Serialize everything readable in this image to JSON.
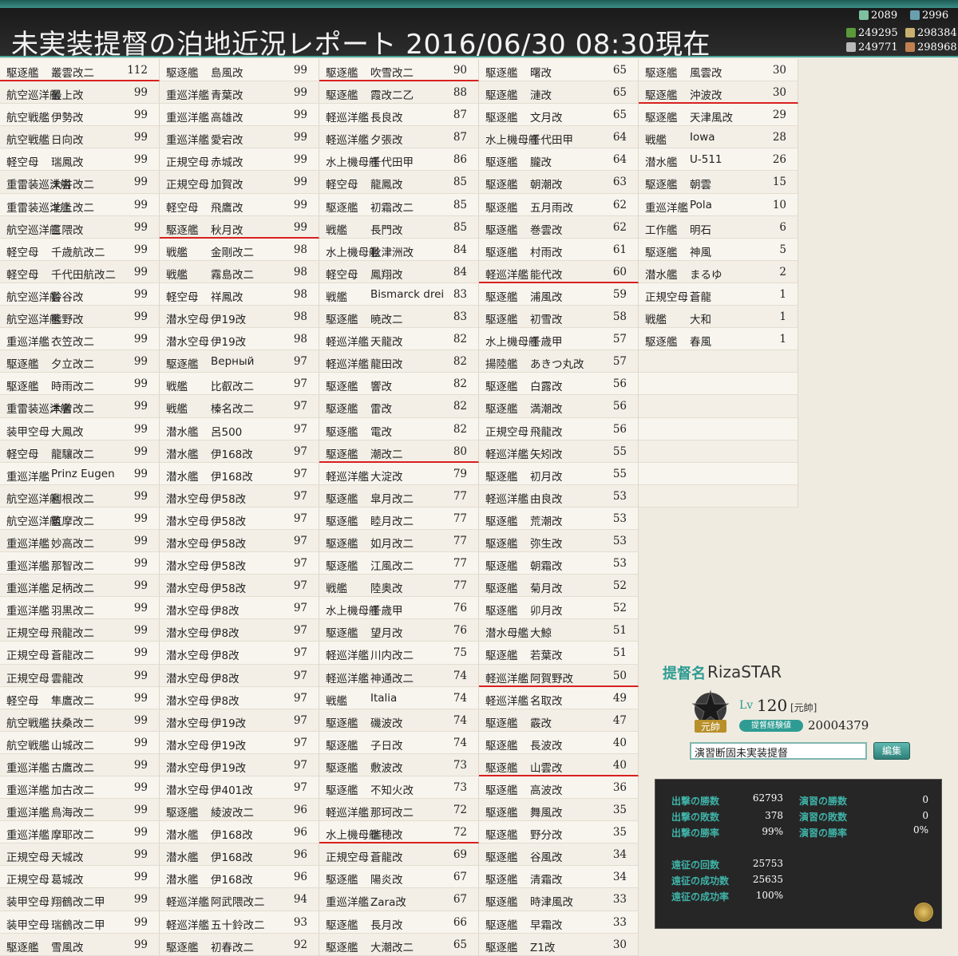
{
  "title": "未実装提督の泊地近況レポート 2016/06/30 08:30現在",
  "resources": {
    "bucket": "2089",
    "dev_material": "2996",
    "fuel": "249295",
    "ammo": "298384",
    "steel": "249771",
    "bauxite": "298968"
  },
  "columns": [
    [
      {
        "t": "駆逐艦",
        "n": "叢雲改二",
        "lv": "112",
        "m": true
      },
      {
        "t": "航空巡洋艦",
        "n": "最上改",
        "lv": "99"
      },
      {
        "t": "航空戦艦",
        "n": "伊勢改",
        "lv": "99"
      },
      {
        "t": "航空戦艦",
        "n": "日向改",
        "lv": "99"
      },
      {
        "t": "軽空母",
        "n": "瑞鳳改",
        "lv": "99"
      },
      {
        "t": "重雷装巡洋艦",
        "n": "大井改二",
        "lv": "99"
      },
      {
        "t": "重雷装巡洋艦",
        "n": "北上改二",
        "lv": "99"
      },
      {
        "t": "航空巡洋艦",
        "n": "三隈改",
        "lv": "99"
      },
      {
        "t": "軽空母",
        "n": "千歳航改二",
        "lv": "99"
      },
      {
        "t": "軽空母",
        "n": "千代田航改二",
        "lv": "99"
      },
      {
        "t": "航空巡洋艦",
        "n": "鈴谷改",
        "lv": "99"
      },
      {
        "t": "航空巡洋艦",
        "n": "熊野改",
        "lv": "99"
      },
      {
        "t": "重巡洋艦",
        "n": "衣笠改二",
        "lv": "99"
      },
      {
        "t": "駆逐艦",
        "n": "夕立改二",
        "lv": "99"
      },
      {
        "t": "駆逐艦",
        "n": "時雨改二",
        "lv": "99"
      },
      {
        "t": "重雷装巡洋艦",
        "n": "木曾改二",
        "lv": "99"
      },
      {
        "t": "装甲空母",
        "n": "大鳳改",
        "lv": "99"
      },
      {
        "t": "軽空母",
        "n": "龍驤改二",
        "lv": "99"
      },
      {
        "t": "重巡洋艦",
        "n": "Prinz Eugen",
        "lv": "99"
      },
      {
        "t": "航空巡洋艦",
        "n": "利根改二",
        "lv": "99"
      },
      {
        "t": "航空巡洋艦",
        "n": "筑摩改二",
        "lv": "99"
      },
      {
        "t": "重巡洋艦",
        "n": "妙高改二",
        "lv": "99"
      },
      {
        "t": "重巡洋艦",
        "n": "那智改二",
        "lv": "99"
      },
      {
        "t": "重巡洋艦",
        "n": "足柄改二",
        "lv": "99"
      },
      {
        "t": "重巡洋艦",
        "n": "羽黒改二",
        "lv": "99"
      },
      {
        "t": "正規空母",
        "n": "飛龍改二",
        "lv": "99"
      },
      {
        "t": "正規空母",
        "n": "蒼龍改二",
        "lv": "99"
      },
      {
        "t": "正規空母",
        "n": "雲龍改",
        "lv": "99"
      },
      {
        "t": "軽空母",
        "n": "隼鷹改二",
        "lv": "99"
      },
      {
        "t": "航空戦艦",
        "n": "扶桑改二",
        "lv": "99"
      },
      {
        "t": "航空戦艦",
        "n": "山城改二",
        "lv": "99"
      },
      {
        "t": "重巡洋艦",
        "n": "古鷹改二",
        "lv": "99"
      },
      {
        "t": "重巡洋艦",
        "n": "加古改二",
        "lv": "99"
      },
      {
        "t": "重巡洋艦",
        "n": "鳥海改二",
        "lv": "99"
      },
      {
        "t": "重巡洋艦",
        "n": "摩耶改二",
        "lv": "99"
      },
      {
        "t": "正規空母",
        "n": "天城改",
        "lv": "99"
      },
      {
        "t": "正規空母",
        "n": "葛城改",
        "lv": "99"
      },
      {
        "t": "装甲空母",
        "n": "翔鶴改二甲",
        "lv": "99"
      },
      {
        "t": "装甲空母",
        "n": "瑞鶴改二甲",
        "lv": "99"
      },
      {
        "t": "駆逐艦",
        "n": "雪風改",
        "lv": "99"
      }
    ],
    [
      {
        "t": "駆逐艦",
        "n": "島風改",
        "lv": "99"
      },
      {
        "t": "重巡洋艦",
        "n": "青葉改",
        "lv": "99"
      },
      {
        "t": "重巡洋艦",
        "n": "高雄改",
        "lv": "99"
      },
      {
        "t": "重巡洋艦",
        "n": "愛宕改",
        "lv": "99"
      },
      {
        "t": "正規空母",
        "n": "赤城改",
        "lv": "99"
      },
      {
        "t": "正規空母",
        "n": "加賀改",
        "lv": "99"
      },
      {
        "t": "軽空母",
        "n": "飛鷹改",
        "lv": "99"
      },
      {
        "t": "駆逐艦",
        "n": "秋月改",
        "lv": "99",
        "m": true
      },
      {
        "t": "戦艦",
        "n": "金剛改二",
        "lv": "98"
      },
      {
        "t": "戦艦",
        "n": "霧島改二",
        "lv": "98"
      },
      {
        "t": "軽空母",
        "n": "祥鳳改",
        "lv": "98"
      },
      {
        "t": "潜水空母",
        "n": "伊19改",
        "lv": "98"
      },
      {
        "t": "潜水空母",
        "n": "伊19改",
        "lv": "98"
      },
      {
        "t": "駆逐艦",
        "n": "Верный",
        "lv": "97"
      },
      {
        "t": "戦艦",
        "n": "比叡改二",
        "lv": "97"
      },
      {
        "t": "戦艦",
        "n": "榛名改二",
        "lv": "97"
      },
      {
        "t": "潜水艦",
        "n": "呂500",
        "lv": "97"
      },
      {
        "t": "潜水艦",
        "n": "伊168改",
        "lv": "97"
      },
      {
        "t": "潜水艦",
        "n": "伊168改",
        "lv": "97"
      },
      {
        "t": "潜水空母",
        "n": "伊58改",
        "lv": "97"
      },
      {
        "t": "潜水空母",
        "n": "伊58改",
        "lv": "97"
      },
      {
        "t": "潜水空母",
        "n": "伊58改",
        "lv": "97"
      },
      {
        "t": "潜水空母",
        "n": "伊58改",
        "lv": "97"
      },
      {
        "t": "潜水空母",
        "n": "伊58改",
        "lv": "97"
      },
      {
        "t": "潜水空母",
        "n": "伊8改",
        "lv": "97"
      },
      {
        "t": "潜水空母",
        "n": "伊8改",
        "lv": "97"
      },
      {
        "t": "潜水空母",
        "n": "伊8改",
        "lv": "97"
      },
      {
        "t": "潜水空母",
        "n": "伊8改",
        "lv": "97"
      },
      {
        "t": "潜水空母",
        "n": "伊8改",
        "lv": "97"
      },
      {
        "t": "潜水空母",
        "n": "伊19改",
        "lv": "97"
      },
      {
        "t": "潜水空母",
        "n": "伊19改",
        "lv": "97"
      },
      {
        "t": "潜水空母",
        "n": "伊19改",
        "lv": "97"
      },
      {
        "t": "潜水空母",
        "n": "伊401改",
        "lv": "97"
      },
      {
        "t": "駆逐艦",
        "n": "綾波改二",
        "lv": "96"
      },
      {
        "t": "潜水艦",
        "n": "伊168改",
        "lv": "96"
      },
      {
        "t": "潜水艦",
        "n": "伊168改",
        "lv": "96"
      },
      {
        "t": "潜水艦",
        "n": "伊168改",
        "lv": "96"
      },
      {
        "t": "軽巡洋艦",
        "n": "阿武隈改二",
        "lv": "94"
      },
      {
        "t": "軽巡洋艦",
        "n": "五十鈴改二",
        "lv": "93"
      },
      {
        "t": "駆逐艦",
        "n": "初春改二",
        "lv": "92"
      }
    ],
    [
      {
        "t": "駆逐艦",
        "n": "吹雪改二",
        "lv": "90",
        "m": true
      },
      {
        "t": "駆逐艦",
        "n": "霞改二乙",
        "lv": "88"
      },
      {
        "t": "軽巡洋艦",
        "n": "長良改",
        "lv": "87"
      },
      {
        "t": "軽巡洋艦",
        "n": "夕張改",
        "lv": "87"
      },
      {
        "t": "水上機母艦",
        "n": "千代田甲",
        "lv": "86"
      },
      {
        "t": "軽空母",
        "n": "龍鳳改",
        "lv": "85"
      },
      {
        "t": "駆逐艦",
        "n": "初霜改二",
        "lv": "85"
      },
      {
        "t": "戦艦",
        "n": "長門改",
        "lv": "85"
      },
      {
        "t": "水上機母艦",
        "n": "秋津洲改",
        "lv": "84"
      },
      {
        "t": "軽空母",
        "n": "鳳翔改",
        "lv": "84"
      },
      {
        "t": "戦艦",
        "n": "Bismarck drei",
        "lv": "83"
      },
      {
        "t": "駆逐艦",
        "n": "暁改二",
        "lv": "83"
      },
      {
        "t": "軽巡洋艦",
        "n": "天龍改",
        "lv": "82"
      },
      {
        "t": "軽巡洋艦",
        "n": "龍田改",
        "lv": "82"
      },
      {
        "t": "駆逐艦",
        "n": "響改",
        "lv": "82"
      },
      {
        "t": "駆逐艦",
        "n": "雷改",
        "lv": "82"
      },
      {
        "t": "駆逐艦",
        "n": "電改",
        "lv": "82"
      },
      {
        "t": "駆逐艦",
        "n": "潮改二",
        "lv": "80",
        "m": true
      },
      {
        "t": "軽巡洋艦",
        "n": "大淀改",
        "lv": "79"
      },
      {
        "t": "駆逐艦",
        "n": "皐月改二",
        "lv": "77"
      },
      {
        "t": "駆逐艦",
        "n": "睦月改二",
        "lv": "77"
      },
      {
        "t": "駆逐艦",
        "n": "如月改二",
        "lv": "77"
      },
      {
        "t": "駆逐艦",
        "n": "江風改二",
        "lv": "77"
      },
      {
        "t": "戦艦",
        "n": "陸奥改",
        "lv": "77"
      },
      {
        "t": "水上機母艦",
        "n": "千歳甲",
        "lv": "76"
      },
      {
        "t": "駆逐艦",
        "n": "望月改",
        "lv": "76"
      },
      {
        "t": "軽巡洋艦",
        "n": "川内改二",
        "lv": "75"
      },
      {
        "t": "軽巡洋艦",
        "n": "神通改二",
        "lv": "74"
      },
      {
        "t": "戦艦",
        "n": "Italia",
        "lv": "74"
      },
      {
        "t": "駆逐艦",
        "n": "磯波改",
        "lv": "74"
      },
      {
        "t": "駆逐艦",
        "n": "子日改",
        "lv": "74"
      },
      {
        "t": "駆逐艦",
        "n": "敷波改",
        "lv": "73"
      },
      {
        "t": "駆逐艦",
        "n": "不知火改",
        "lv": "73"
      },
      {
        "t": "軽巡洋艦",
        "n": "那珂改二",
        "lv": "72"
      },
      {
        "t": "水上機母艦",
        "n": "瑞穂改",
        "lv": "72",
        "m": true
      },
      {
        "t": "正規空母",
        "n": "蒼龍改",
        "lv": "69"
      },
      {
        "t": "駆逐艦",
        "n": "陽炎改",
        "lv": "67"
      },
      {
        "t": "重巡洋艦",
        "n": "Zara改",
        "lv": "67"
      },
      {
        "t": "駆逐艦",
        "n": "長月改",
        "lv": "66"
      },
      {
        "t": "駆逐艦",
        "n": "大潮改二",
        "lv": "65"
      }
    ],
    [
      {
        "t": "駆逐艦",
        "n": "曙改",
        "lv": "65"
      },
      {
        "t": "駆逐艦",
        "n": "漣改",
        "lv": "65"
      },
      {
        "t": "駆逐艦",
        "n": "文月改",
        "lv": "65"
      },
      {
        "t": "水上機母艦",
        "n": "千代田甲",
        "lv": "64"
      },
      {
        "t": "駆逐艦",
        "n": "朧改",
        "lv": "64"
      },
      {
        "t": "駆逐艦",
        "n": "朝潮改",
        "lv": "63"
      },
      {
        "t": "駆逐艦",
        "n": "五月雨改",
        "lv": "62"
      },
      {
        "t": "駆逐艦",
        "n": "巻雲改",
        "lv": "62"
      },
      {
        "t": "駆逐艦",
        "n": "村雨改",
        "lv": "61"
      },
      {
        "t": "軽巡洋艦",
        "n": "能代改",
        "lv": "60",
        "m": true
      },
      {
        "t": "駆逐艦",
        "n": "浦風改",
        "lv": "59"
      },
      {
        "t": "駆逐艦",
        "n": "初雪改",
        "lv": "58"
      },
      {
        "t": "水上機母艦",
        "n": "千歳甲",
        "lv": "57"
      },
      {
        "t": "揚陸艦",
        "n": "あきつ丸改",
        "lv": "57"
      },
      {
        "t": "駆逐艦",
        "n": "白露改",
        "lv": "56"
      },
      {
        "t": "駆逐艦",
        "n": "満潮改",
        "lv": "56"
      },
      {
        "t": "正規空母",
        "n": "飛龍改",
        "lv": "56"
      },
      {
        "t": "軽巡洋艦",
        "n": "矢矧改",
        "lv": "55"
      },
      {
        "t": "駆逐艦",
        "n": "初月改",
        "lv": "55"
      },
      {
        "t": "軽巡洋艦",
        "n": "由良改",
        "lv": "53"
      },
      {
        "t": "駆逐艦",
        "n": "荒潮改",
        "lv": "53"
      },
      {
        "t": "駆逐艦",
        "n": "弥生改",
        "lv": "53"
      },
      {
        "t": "駆逐艦",
        "n": "朝霜改",
        "lv": "53"
      },
      {
        "t": "駆逐艦",
        "n": "菊月改",
        "lv": "52"
      },
      {
        "t": "駆逐艦",
        "n": "卯月改",
        "lv": "52"
      },
      {
        "t": "潜水母艦",
        "n": "大鯨",
        "lv": "51"
      },
      {
        "t": "駆逐艦",
        "n": "若葉改",
        "lv": "51"
      },
      {
        "t": "軽巡洋艦",
        "n": "阿賀野改",
        "lv": "50",
        "m": true
      },
      {
        "t": "軽巡洋艦",
        "n": "名取改",
        "lv": "49"
      },
      {
        "t": "駆逐艦",
        "n": "霰改",
        "lv": "47"
      },
      {
        "t": "駆逐艦",
        "n": "長波改",
        "lv": "40"
      },
      {
        "t": "駆逐艦",
        "n": "山雲改",
        "lv": "40",
        "m": true
      },
      {
        "t": "駆逐艦",
        "n": "高波改",
        "lv": "36"
      },
      {
        "t": "駆逐艦",
        "n": "舞風改",
        "lv": "35"
      },
      {
        "t": "駆逐艦",
        "n": "野分改",
        "lv": "35"
      },
      {
        "t": "駆逐艦",
        "n": "谷風改",
        "lv": "34"
      },
      {
        "t": "駆逐艦",
        "n": "清霜改",
        "lv": "34"
      },
      {
        "t": "駆逐艦",
        "n": "時津風改",
        "lv": "33"
      },
      {
        "t": "駆逐艦",
        "n": "早霜改",
        "lv": "33"
      },
      {
        "t": "駆逐艦",
        "n": "Z1改",
        "lv": "30"
      }
    ],
    [
      {
        "t": "駆逐艦",
        "n": "風雲改",
        "lv": "30"
      },
      {
        "t": "駆逐艦",
        "n": "沖波改",
        "lv": "30",
        "m": true
      },
      {
        "t": "駆逐艦",
        "n": "天津風改",
        "lv": "29"
      },
      {
        "t": "戦艦",
        "n": "Iowa",
        "lv": "28"
      },
      {
        "t": "潜水艦",
        "n": "U-511",
        "lv": "26"
      },
      {
        "t": "駆逐艦",
        "n": "朝雲",
        "lv": "15"
      },
      {
        "t": "重巡洋艦",
        "n": "Pola",
        "lv": "10"
      },
      {
        "t": "工作艦",
        "n": "明石",
        "lv": "6"
      },
      {
        "t": "駆逐艦",
        "n": "神風",
        "lv": "5"
      },
      {
        "t": "潜水艦",
        "n": "まるゆ",
        "lv": "2"
      },
      {
        "t": "正規空母",
        "n": "蒼龍",
        "lv": "1"
      },
      {
        "t": "戦艦",
        "n": "大和",
        "lv": "1"
      },
      {
        "t": "駆逐艦",
        "n": "春風",
        "lv": "1"
      },
      {
        "t": "",
        "n": "",
        "lv": ""
      },
      {
        "t": "",
        "n": "",
        "lv": ""
      },
      {
        "t": "",
        "n": "",
        "lv": ""
      },
      {
        "t": "",
        "n": "",
        "lv": ""
      },
      {
        "t": "",
        "n": "",
        "lv": ""
      },
      {
        "t": "",
        "n": "",
        "lv": ""
      },
      {
        "t": "",
        "n": "",
        "lv": ""
      }
    ]
  ],
  "profile": {
    "name_label": "提督名",
    "name": "RizaSTAR",
    "emblem_text": "元帥",
    "lv_label": "Lv",
    "level": "120",
    "rank": "[元帥]",
    "exp_label": "提督経験値",
    "exp": "20004379",
    "comment": "演習断固未実装提督",
    "edit_label": "編集"
  },
  "stats": {
    "sortie_wins_label": "出撃の勝数",
    "sortie_wins": "62793",
    "sortie_losses_label": "出撃の敗数",
    "sortie_losses": "378",
    "sortie_rate_label": "出撃の勝率",
    "sortie_rate": "99%",
    "practice_wins_label": "演習の勝数",
    "practice_wins": "0",
    "practice_losses_label": "演習の敗数",
    "practice_losses": "0",
    "practice_rate_label": "演習の勝率",
    "practice_rate": "0%",
    "expedition_count_label": "遠征の回数",
    "expedition_count": "25753",
    "expedition_success_label": "遠征の成功数",
    "expedition_success": "25635",
    "expedition_rate_label": "遠征の成功率",
    "expedition_rate": "100%"
  },
  "colors": {
    "accent": "#2e9c93",
    "mark_line": "#d92020",
    "header_bg": "#1f1f1f"
  }
}
